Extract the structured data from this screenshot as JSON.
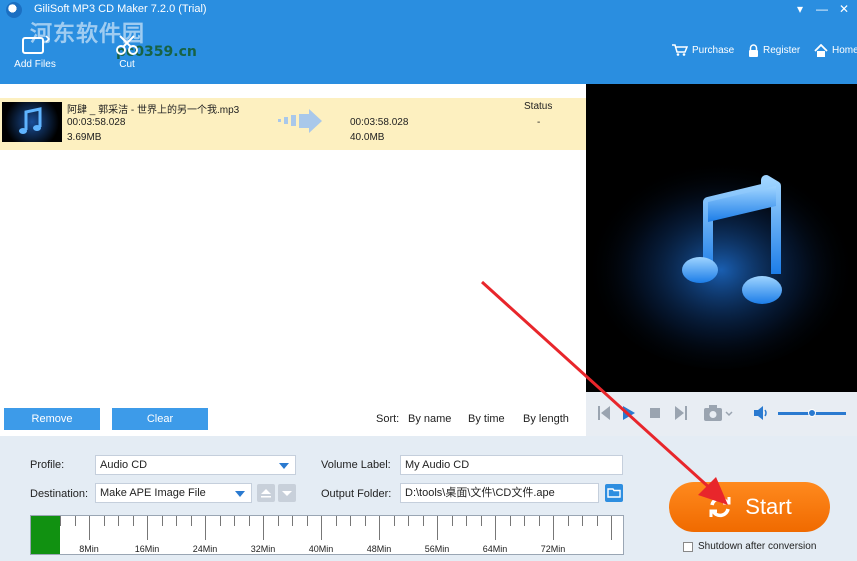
{
  "app": {
    "title": "GiliSoft MP3 CD Maker 7.2.0 (Trial)",
    "watermark": "河东软件园",
    "watermark_url": "pc0359.cn"
  },
  "toolbar": {
    "add_files": "Add Files",
    "cut": "Cut"
  },
  "nav": {
    "purchase": "Purchase",
    "register": "Register",
    "home": "Home"
  },
  "file": {
    "name": "阿肆 _ 郭采洁 - 世界上的另一个我.mp3",
    "duration": "00:03:58.028",
    "size": "3.69MB",
    "out_duration": "00:03:58.028",
    "out_size": "40.0MB",
    "status_header": "Status",
    "status_value": "-"
  },
  "list_actions": {
    "remove": "Remove",
    "clear": "Clear"
  },
  "sort": {
    "label": "Sort:",
    "by_name": "By name",
    "by_time": "By time",
    "by_length": "By length"
  },
  "player": {
    "volume": 0.5
  },
  "settings": {
    "profile_label": "Profile:",
    "profile_value": "Audio CD",
    "destination_label": "Destination:",
    "destination_value": "Make APE Image File",
    "volume_label_label": "Volume Label:",
    "volume_label_value": "My Audio CD",
    "output_folder_label": "Output Folder:",
    "output_folder_value": "D:\\tools\\桌面\\文件\\CD文件.ape"
  },
  "timeline": {
    "ticks": [
      "8Min",
      "16Min",
      "24Min",
      "32Min",
      "40Min",
      "48Min",
      "56Min",
      "64Min",
      "72Min"
    ],
    "used_fraction": 0.049
  },
  "start": {
    "label": "Start",
    "shutdown_label": "Shutdown after conversion"
  },
  "colors": {
    "accent": "#2a8ee0",
    "start": "#f57a0f",
    "highlight_row": "#fdf0c0",
    "timeline_fill": "#119111",
    "annotation": "#e8262b"
  }
}
